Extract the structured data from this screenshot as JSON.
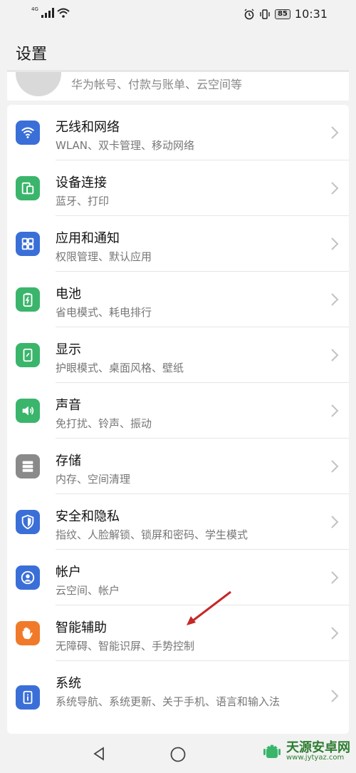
{
  "status_bar": {
    "network": "4G",
    "battery": "85",
    "time": "10:31"
  },
  "page_title": "设置",
  "account": {
    "subtitle": "华为帐号、付款与账单、云空间等"
  },
  "colors": {
    "blue": "#3a6fd8",
    "green": "#3ab56b",
    "gray": "#8a8a8a",
    "orange": "#f07a2a",
    "arrow": "#c62828"
  },
  "settings": [
    {
      "title": "无线和网络",
      "subtitle": "WLAN、双卡管理、移动网络",
      "icon": "wifi-icon"
    },
    {
      "title": "设备连接",
      "subtitle": "蓝牙、打印",
      "icon": "device-connection-icon"
    },
    {
      "title": "应用和通知",
      "subtitle": "权限管理、默认应用",
      "icon": "apps-grid-icon"
    },
    {
      "title": "电池",
      "subtitle": "省电模式、耗电排行",
      "icon": "battery-icon"
    },
    {
      "title": "显示",
      "subtitle": "护眼模式、桌面风格、壁纸",
      "icon": "display-icon"
    },
    {
      "title": "声音",
      "subtitle": "免打扰、铃声、振动",
      "icon": "sound-icon"
    },
    {
      "title": "存储",
      "subtitle": "内存、空间清理",
      "icon": "storage-icon"
    },
    {
      "title": "安全和隐私",
      "subtitle": "指纹、人脸解锁、锁屏和密码、学生模式",
      "icon": "shield-icon"
    },
    {
      "title": "帐户",
      "subtitle": "云空间、帐户",
      "icon": "account-icon"
    },
    {
      "title": "智能辅助",
      "subtitle": "无障碍、智能识屏、手势控制",
      "icon": "hand-icon"
    },
    {
      "title": "系统",
      "subtitle": "系统导航、系统更新、关于手机、语言和输入法",
      "icon": "system-info-icon"
    }
  ],
  "watermark": {
    "name": "天源安卓网",
    "url": "www.jytyaz.com"
  }
}
